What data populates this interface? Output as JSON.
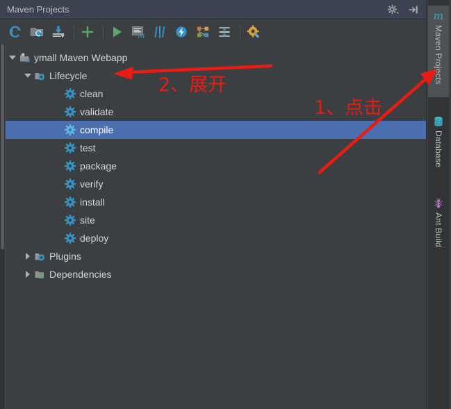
{
  "window": {
    "title": "Maven Projects",
    "actions": [
      {
        "name": "settings-gear-dropdown",
        "icon": "gear-dropdown-icon",
        "label": "Settings"
      },
      {
        "name": "hide-tool-window",
        "icon": "hide-panel-icon",
        "label": "Hide"
      }
    ]
  },
  "toolbar": {
    "buttons": [
      {
        "name": "reimport-button",
        "icon": "refresh-icon",
        "label": "Reimport All Maven Projects"
      },
      {
        "name": "add-maven-project-button",
        "icon": "add-folder-icon",
        "label": "Add Maven Projects"
      },
      {
        "name": "download-sources-button",
        "icon": "download-icon",
        "label": "Download Sources and/or Documentation"
      },
      {
        "name": "add-button",
        "icon": "plus-icon",
        "label": "Add"
      },
      {
        "name": "run-build-button",
        "icon": "run-icon",
        "label": "Run Maven Build"
      },
      {
        "name": "execute-goal-button",
        "icon": "maven-console-icon",
        "label": "Execute Maven Goal"
      },
      {
        "name": "toggle-skip-tests-button",
        "icon": "skip-tests-icon",
        "label": "Toggle 'Skip Tests' Mode"
      },
      {
        "name": "toggle-offline-button",
        "icon": "offline-icon",
        "label": "Toggle Offline Mode"
      },
      {
        "name": "show-dependencies-button",
        "icon": "dependency-graph-icon",
        "label": "Show Dependencies"
      },
      {
        "name": "collapse-all-button",
        "icon": "collapse-all-icon",
        "label": "Collapse All"
      },
      {
        "name": "maven-settings-button",
        "icon": "maven-settings-icon",
        "label": "Maven Settings"
      }
    ]
  },
  "tree": {
    "nodes": [
      {
        "label": "ymall Maven Webapp",
        "icon": "maven-module-icon",
        "indent": 0,
        "twisty": "down",
        "selected": false
      },
      {
        "label": "Lifecycle",
        "icon": "lifecycle-folder-icon",
        "indent": 1,
        "twisty": "down",
        "selected": false
      },
      {
        "label": "clean",
        "icon": "goal-gear-icon",
        "indent": 2,
        "twisty": "none",
        "selected": false
      },
      {
        "label": "validate",
        "icon": "goal-gear-icon",
        "indent": 2,
        "twisty": "none",
        "selected": false
      },
      {
        "label": "compile",
        "icon": "goal-gear-icon",
        "indent": 2,
        "twisty": "none",
        "selected": true
      },
      {
        "label": "test",
        "icon": "goal-gear-icon",
        "indent": 2,
        "twisty": "none",
        "selected": false
      },
      {
        "label": "package",
        "icon": "goal-gear-icon",
        "indent": 2,
        "twisty": "none",
        "selected": false
      },
      {
        "label": "verify",
        "icon": "goal-gear-icon",
        "indent": 2,
        "twisty": "none",
        "selected": false
      },
      {
        "label": "install",
        "icon": "goal-gear-icon",
        "indent": 2,
        "twisty": "none",
        "selected": false
      },
      {
        "label": "site",
        "icon": "goal-gear-icon",
        "indent": 2,
        "twisty": "none",
        "selected": false
      },
      {
        "label": "deploy",
        "icon": "goal-gear-icon",
        "indent": 2,
        "twisty": "none",
        "selected": false
      },
      {
        "label": "Plugins",
        "icon": "plugins-folder-icon",
        "indent": 1,
        "twisty": "right",
        "selected": false
      },
      {
        "label": "Dependencies",
        "icon": "dependencies-folder-icon",
        "indent": 1,
        "twisty": "right",
        "selected": false
      }
    ]
  },
  "right_tool_bar": {
    "tabs": [
      {
        "label": "Maven Projects",
        "icon": "maven-m-icon",
        "active": true
      },
      {
        "label": "Database",
        "icon": "database-icon",
        "active": false
      },
      {
        "label": "Ant Build",
        "icon": "ant-icon",
        "active": false
      }
    ]
  },
  "annotations": {
    "color": "#e81c13",
    "step1_text": "1、点击",
    "step2_text": "2、展开"
  },
  "colors": {
    "panel_background": "#3c3f41",
    "titlebar_background": "#3c4350",
    "selection_blue": "#4b6eaf",
    "text": "#d4d4d4",
    "annotation_red": "#e81c13",
    "icon_cyan": "#3592c4",
    "icon_green": "#59a869"
  }
}
